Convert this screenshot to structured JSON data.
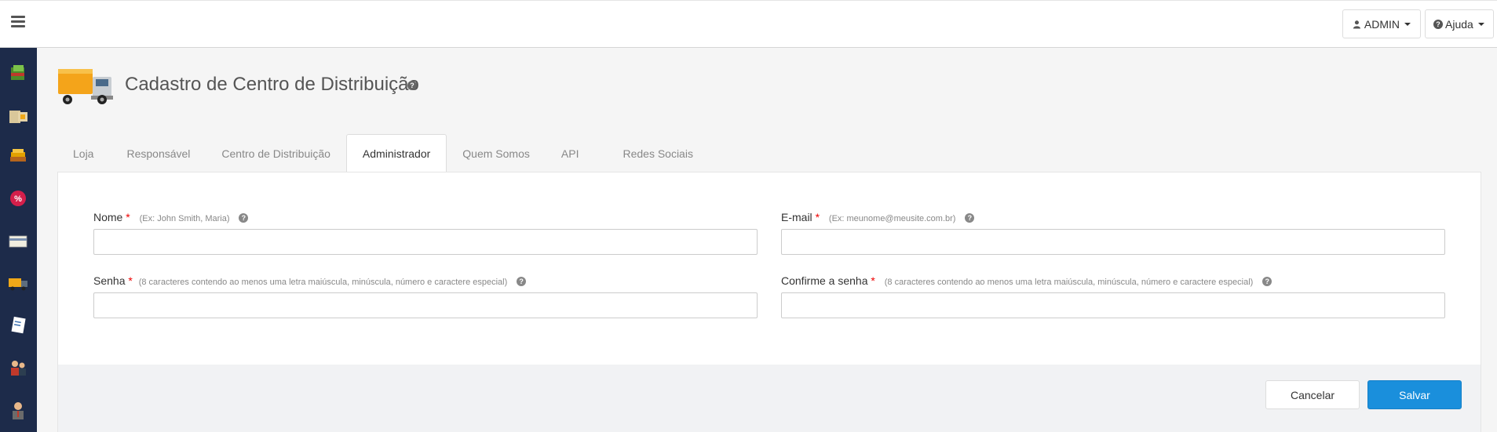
{
  "topbar": {
    "user_label": "ADMIN",
    "help_label": "Ajuda"
  },
  "sidebar": {
    "items": [
      {
        "icon": "package-icon",
        "color": "#5aa02c"
      },
      {
        "icon": "boxes-icon",
        "color": "#d9b87a"
      },
      {
        "icon": "stack-icon",
        "color": "#e2a100"
      },
      {
        "icon": "percent-icon",
        "color": "#d41f4b"
      },
      {
        "icon": "card-icon",
        "color": "#e8e4d0"
      },
      {
        "icon": "truck-icon",
        "color": "#f0a818"
      },
      {
        "icon": "document-icon",
        "color": "#ffffff"
      },
      {
        "icon": "users-icon",
        "color": "#c0392b"
      },
      {
        "icon": "person-icon",
        "color": "#8a7a6a"
      }
    ]
  },
  "header": {
    "title": "Cadastro de Centro de Distribuição"
  },
  "tabs": [
    {
      "label": "Loja"
    },
    {
      "label": "Responsável"
    },
    {
      "label": "Centro de Distribuição"
    },
    {
      "label": "Administrador"
    },
    {
      "label": "Quem Somos"
    },
    {
      "label": "API"
    },
    {
      "label": "Redes Sociais"
    }
  ],
  "form": {
    "nome": {
      "label": "Nome",
      "required": "*",
      "hint": "(Ex: John Smith, Maria)",
      "value": ""
    },
    "email": {
      "label": "E-mail",
      "required": "*",
      "hint": "(Ex: meunome@meusite.com.br)",
      "value": ""
    },
    "senha": {
      "label": "Senha",
      "required": "*",
      "hint": "(8 caracteres contendo ao menos uma letra maiúscula, minúscula, número e caractere especial)",
      "value": ""
    },
    "confirme": {
      "label": "Confirme a senha",
      "required": "*",
      "hint": "(8 caracteres contendo ao menos uma letra maiúscula, minúscula, número e caractere especial)",
      "value": ""
    }
  },
  "buttons": {
    "cancel": "Cancelar",
    "save": "Salvar"
  },
  "colors": {
    "sidebar": "#1d2b4a",
    "primary": "#1a8fdc",
    "required": "#e00000"
  }
}
